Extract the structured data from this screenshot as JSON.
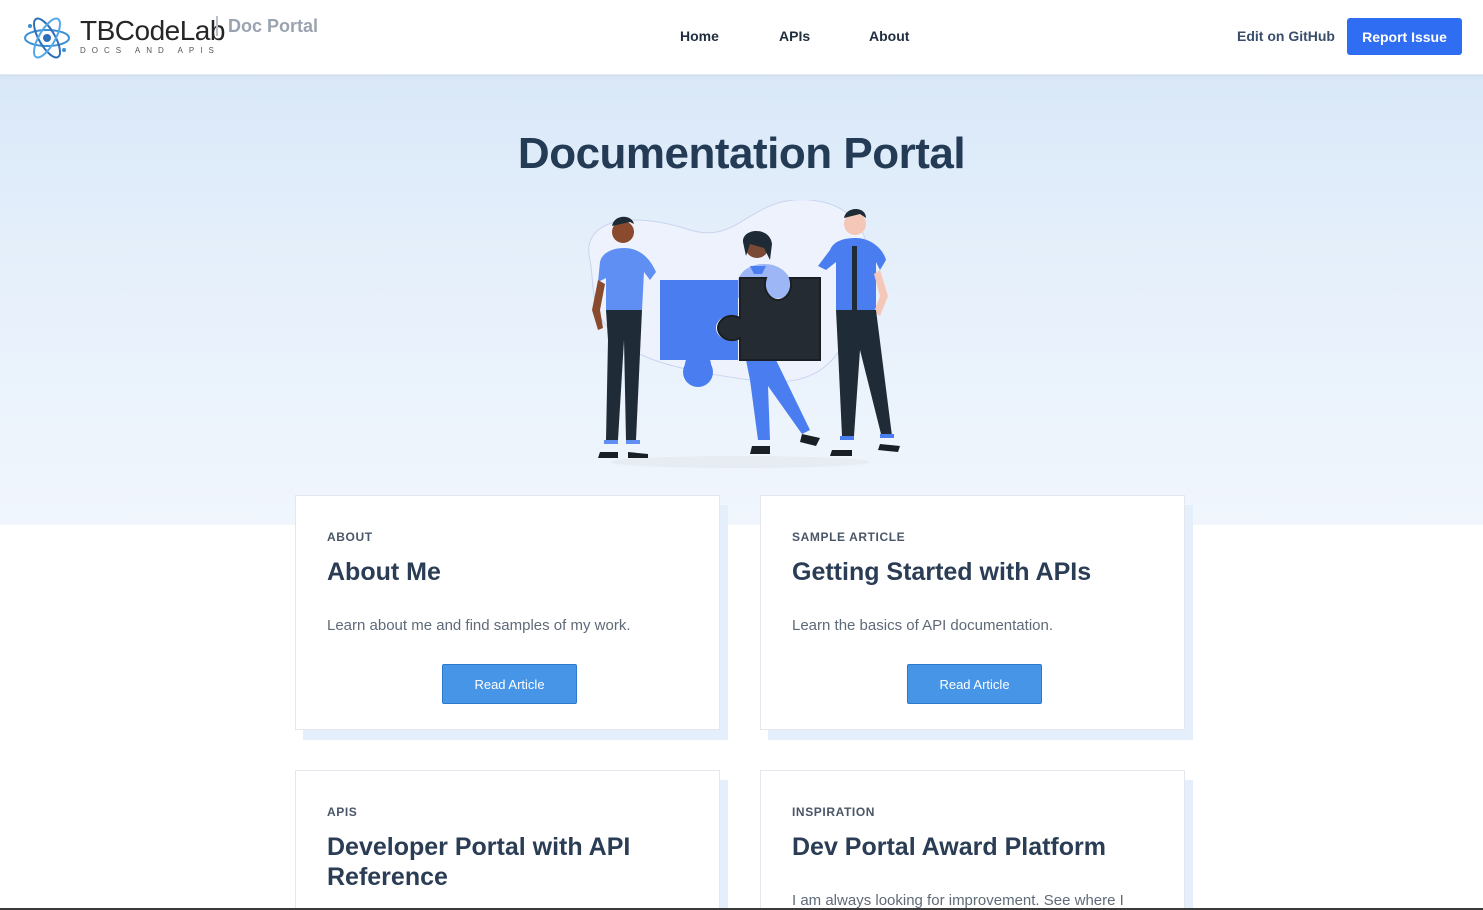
{
  "header": {
    "logo_name": "TBCodeLab",
    "logo_tagline": "DOCS AND APIS",
    "portal_name": "Doc Portal",
    "nav": [
      {
        "label": "Home"
      },
      {
        "label": "APIs"
      },
      {
        "label": "About"
      }
    ],
    "edit_link": "Edit on GitHub",
    "report_button": "Report Issue"
  },
  "hero": {
    "title": "Documentation Portal"
  },
  "cards": [
    {
      "eyebrow": "ABOUT",
      "title": "About Me",
      "description": "Learn about me and find samples of my work.",
      "button": "Read Article"
    },
    {
      "eyebrow": "SAMPLE ARTICLE",
      "title": "Getting Started with APIs",
      "description": "Learn the basics of API documentation.",
      "button": "Read Article"
    },
    {
      "eyebrow": "APIS",
      "title": "Developer Portal with API Reference",
      "description": ""
    },
    {
      "eyebrow": "INSPIRATION",
      "title": "Dev Portal Award Platform",
      "description": "I am always looking for improvement. See where I"
    }
  ],
  "colors": {
    "primary_button": "#2f6df2",
    "card_button": "#4795e6",
    "heading": "#243b55",
    "hero_bg": "#e6f0fb"
  }
}
